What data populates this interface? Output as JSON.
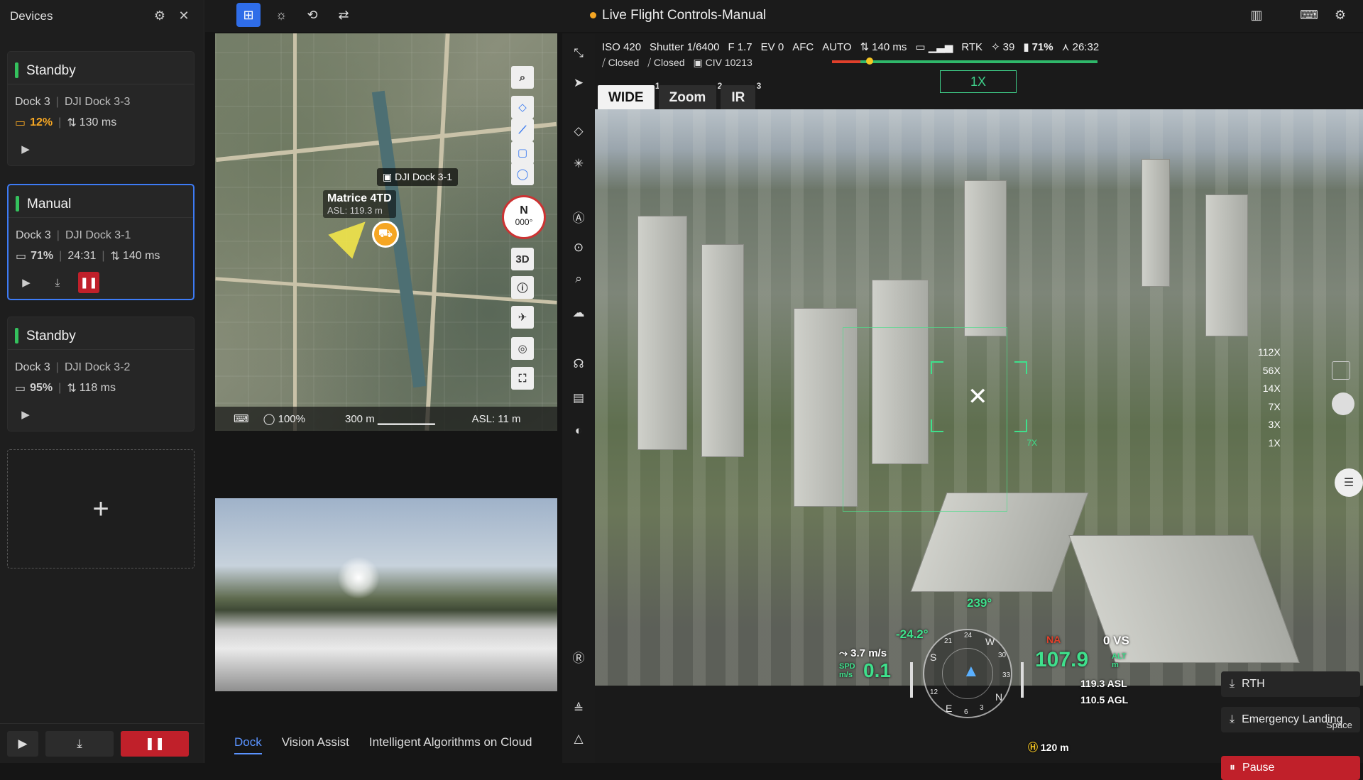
{
  "sidebar": {
    "title": "Devices",
    "cards": [
      {
        "status": "Standby",
        "dock": "Dock 3",
        "name": "DJI Dock 3-3",
        "battery": "12%",
        "latency": "130 ms"
      },
      {
        "status": "Manual",
        "dock": "Dock 3",
        "name": "DJI Dock 3-1",
        "battery": "71%",
        "time": "24:31",
        "latency": "140 ms"
      },
      {
        "status": "Standby",
        "dock": "Dock 3",
        "name": "DJI Dock 3-2",
        "battery": "95%",
        "latency": "118 ms"
      }
    ]
  },
  "topbar": {
    "title": "Live Flight Controls-Manual"
  },
  "map": {
    "drone_name": "Matrice 4TD",
    "drone_asl": "ASL: 119.3 m",
    "dock_label": "DJI Dock 3-1",
    "compass": {
      "n": "N",
      "deg": "000°"
    },
    "btn_3d": "3D",
    "zoom": "100%",
    "scale": "300 m",
    "asl": "ASL: 11 m"
  },
  "bottom_tabs": [
    "Dock",
    "Vision Assist",
    "Intelligent Algorithms on Cloud"
  ],
  "camera": {
    "iso": "ISO 420",
    "shutter": "Shutter 1/6400",
    "f": "F 1.7",
    "ev": "EV 0",
    "afc": "AFC",
    "auto": "AUTO",
    "closed1": "Closed",
    "closed2": "Closed",
    "civ": "CIV 10213",
    "latency": "140 ms",
    "rtk": "RTK",
    "rtk_count": "39",
    "battery": "71%",
    "time": "26:32",
    "zoom": "1X",
    "lens": [
      {
        "label": "WIDE",
        "key": "1"
      },
      {
        "label": "Zoom",
        "key": "2"
      },
      {
        "label": "IR",
        "key": "3"
      }
    ],
    "target_zoom": "7X",
    "zoom_scale": [
      "112X",
      "56X",
      "14X",
      "7X",
      "3X",
      "1X"
    ]
  },
  "hud": {
    "heading": "239°",
    "pitch": "-24.2°",
    "wind": "3.7 m/s",
    "spd_label": "SPD",
    "spd_unit": "m/s",
    "speed": "0.1",
    "na": "NA",
    "vs": "0 VS",
    "alt": "107.9",
    "alt_label": "ALT",
    "alt_unit": "m",
    "asl": "119.3 ASL",
    "agl": "110.5 AGL",
    "home": "120 m",
    "compass": [
      "S",
      "21",
      "24",
      "W",
      "30",
      "33",
      "N",
      "3",
      "6",
      "E",
      "12"
    ]
  },
  "controls": {
    "rth": "RTH",
    "emergency": "Emergency Landing",
    "space": "Space",
    "pause": "Pause"
  }
}
